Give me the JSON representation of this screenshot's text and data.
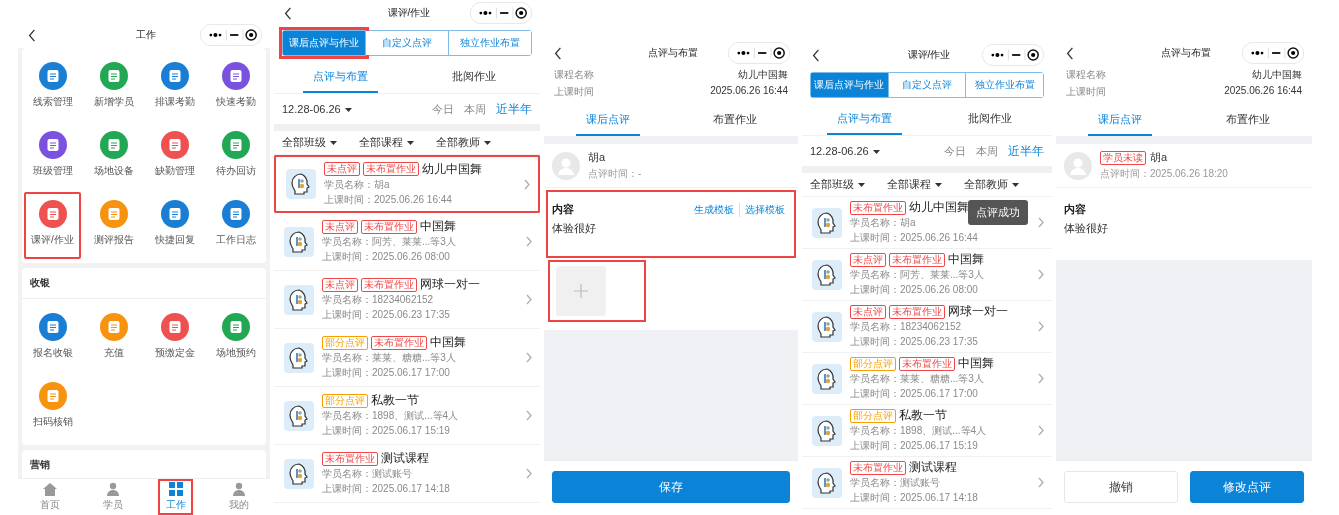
{
  "screens": [
    {
      "kind": "work_menu",
      "title": "工作",
      "sections": [
        {
          "items": [
            {
              "label": "线索管理",
              "color": "#1a7fd4",
              "highlighted": false
            },
            {
              "label": "新增学员",
              "color": "#22a855",
              "highlighted": false
            },
            {
              "label": "排课考勤",
              "color": "#1a7fd4",
              "highlighted": false
            },
            {
              "label": "快速考勤",
              "color": "#7b52e0",
              "highlighted": false
            },
            {
              "label": "班级管理",
              "color": "#7b52e0",
              "highlighted": false
            },
            {
              "label": "场地设备",
              "color": "#22a855",
              "highlighted": false
            },
            {
              "label": "缺勤管理",
              "color": "#ef5050",
              "highlighted": false
            },
            {
              "label": "待办回访",
              "color": "#22a855",
              "highlighted": false
            },
            {
              "label": "课评/作业",
              "color": "#ef5050",
              "highlighted": true
            },
            {
              "label": "测评报告",
              "color": "#f7930e",
              "highlighted": false
            },
            {
              "label": "快捷回复",
              "color": "#1a7fd4",
              "highlighted": false
            },
            {
              "label": "工作日志",
              "color": "#1a7fd4",
              "highlighted": false
            }
          ]
        },
        {
          "title": "收银",
          "items": [
            {
              "label": "报名收银",
              "color": "#1a7fd4",
              "highlighted": false
            },
            {
              "label": "充值",
              "color": "#f7930e",
              "highlighted": false
            },
            {
              "label": "预缴定金",
              "color": "#ef5050",
              "highlighted": false
            },
            {
              "label": "场地预约",
              "color": "#22a855",
              "highlighted": false
            },
            {
              "label": "扫码核销",
              "color": "#f7930e",
              "highlighted": false
            }
          ]
        },
        {
          "title": "营销"
        }
      ],
      "nav": [
        {
          "label": "首页",
          "kind": "home",
          "selected": false,
          "highlighted": false
        },
        {
          "label": "学员",
          "kind": "person",
          "selected": false,
          "highlighted": false
        },
        {
          "label": "工作",
          "kind": "grid",
          "selected": true,
          "highlighted": true
        },
        {
          "label": "我的",
          "kind": "person",
          "selected": false,
          "highlighted": false
        }
      ]
    },
    {
      "kind": "lesson_list",
      "title": "课评/作业",
      "segments": [
        {
          "label": "课后点评与作业",
          "selected": true,
          "highlighted": true
        },
        {
          "label": "自定义点评",
          "selected": false,
          "highlighted": false
        },
        {
          "label": "独立作业布置",
          "selected": false,
          "highlighted": false
        }
      ],
      "tabs": [
        {
          "label": "点评与布置",
          "selected": true
        },
        {
          "label": "批阅作业",
          "selected": false
        }
      ],
      "date_range": "12.28-06.26",
      "quick_ranges": [
        {
          "label": "今日",
          "selected": false
        },
        {
          "label": "本周",
          "selected": false
        },
        {
          "label": "近半年",
          "selected": true
        }
      ],
      "filters": [
        "全部班级",
        "全部课程",
        "全部教师"
      ],
      "lessons": [
        {
          "tags": [
            {
              "label": "未点评",
              "color": "#f04848"
            },
            {
              "label": "未布置作业",
              "color": "#f04848"
            }
          ],
          "title": "幼儿中国舞",
          "students": "学员名称：胡a",
          "time": "上课时间：2025.06.26 16:44",
          "highlighted": true
        },
        {
          "tags": [
            {
              "label": "未点评",
              "color": "#f04848"
            },
            {
              "label": "未布置作业",
              "color": "#f04848"
            }
          ],
          "title": "中国舞",
          "students": "学员名称：阿芳、莱莱...等3人",
          "time": "上课时间：2025.06.26 08:00",
          "highlighted": false
        },
        {
          "tags": [
            {
              "label": "未点评",
              "color": "#f04848"
            },
            {
              "label": "未布置作业",
              "color": "#f04848"
            }
          ],
          "title": "网球一对一",
          "students": "学员名称：18234062152",
          "time": "上课时间：2025.06.23 17:35",
          "highlighted": false
        },
        {
          "tags": [
            {
              "label": "部分点评",
              "color": "#f5a000"
            },
            {
              "label": "未布置作业",
              "color": "#f04848"
            }
          ],
          "title": "中国舞",
          "students": "学员名称：莱莱、糖糖...等3人",
          "time": "上课时间：2025.06.17 17:00",
          "highlighted": false
        },
        {
          "tags": [
            {
              "label": "部分点评",
              "color": "#f5a000"
            }
          ],
          "title": "私教一节",
          "students": "学员名称：1898、测试...等4人",
          "time": "上课时间：2025.06.17 15:19",
          "highlighted": false
        },
        {
          "tags": [
            {
              "label": "未布置作业",
              "color": "#f04848"
            }
          ],
          "title": "测试课程",
          "students": "学员名称：测试账号",
          "time": "上课时间：2025.06.17 14:18",
          "highlighted": false
        }
      ]
    },
    {
      "kind": "review_detail",
      "title": "点评与布置",
      "info": [
        {
          "label": "课程名称",
          "value": "幼儿中国舞"
        },
        {
          "label": "上课时间",
          "value": "2025.06.26 16:44"
        }
      ],
      "tabs": [
        {
          "label": "课后点评",
          "selected": true
        },
        {
          "label": "布置作业",
          "selected": false
        }
      ],
      "student": {
        "name": "胡a",
        "review_time": "点评时间：-"
      },
      "content": {
        "heading": "内容",
        "text": "体验很好",
        "actions": [
          "生成模板",
          "选择模板"
        ],
        "highlighted": true
      },
      "upload": {
        "highlighted": true
      },
      "buttons": [
        {
          "label": "保存",
          "kind": "primary"
        }
      ]
    },
    {
      "kind": "lesson_list",
      "title": "课评/作业",
      "segments": [
        {
          "label": "课后点评与作业",
          "selected": true,
          "highlighted": false
        },
        {
          "label": "自定义点评",
          "selected": false,
          "highlighted": false
        },
        {
          "label": "独立作业布置",
          "selected": false,
          "highlighted": false
        }
      ],
      "tabs": [
        {
          "label": "点评与布置",
          "selected": true
        },
        {
          "label": "批阅作业",
          "selected": false
        }
      ],
      "date_range": "12.28-06.26",
      "quick_ranges": [
        {
          "label": "今日",
          "selected": false
        },
        {
          "label": "本周",
          "selected": false
        },
        {
          "label": "近半年",
          "selected": true
        }
      ],
      "filters": [
        "全部班级",
        "全部课程",
        "全部教师"
      ],
      "toast": "点评成功",
      "lessons": [
        {
          "tags": [
            {
              "label": "未布置作业",
              "color": "#f04848"
            }
          ],
          "title": "幼儿中国舞",
          "students": "学员名称：胡a",
          "time": "上课时间：2025.06.26 16:44",
          "highlighted": false
        },
        {
          "tags": [
            {
              "label": "未点评",
              "color": "#f04848"
            },
            {
              "label": "未布置作业",
              "color": "#f04848"
            }
          ],
          "title": "中国舞",
          "students": "学员名称：阿芳、莱莱...等3人",
          "time": "上课时间：2025.06.26 08:00",
          "highlighted": false
        },
        {
          "tags": [
            {
              "label": "未点评",
              "color": "#f04848"
            },
            {
              "label": "未布置作业",
              "color": "#f04848"
            }
          ],
          "title": "网球一对一",
          "students": "学员名称：18234062152",
          "time": "上课时间：2025.06.23 17:35",
          "highlighted": false
        },
        {
          "tags": [
            {
              "label": "部分点评",
              "color": "#f5a000"
            },
            {
              "label": "未布置作业",
              "color": "#f04848"
            }
          ],
          "title": "中国舞",
          "students": "学员名称：莱莱、糖糖...等3人",
          "time": "上课时间：2025.06.17 17:00",
          "highlighted": false
        },
        {
          "tags": [
            {
              "label": "部分点评",
              "color": "#f5a000"
            }
          ],
          "title": "私教一节",
          "students": "学员名称：1898、测试...等4人",
          "time": "上课时间：2025.06.17 15:19",
          "highlighted": false
        },
        {
          "tags": [
            {
              "label": "未布置作业",
              "color": "#f04848"
            }
          ],
          "title": "测试课程",
          "students": "学员名称：测试账号",
          "time": "上课时间：2025.06.17 14:18",
          "highlighted": false
        }
      ]
    },
    {
      "kind": "review_detail",
      "title": "点评与布置",
      "info": [
        {
          "label": "课程名称",
          "value": "幼儿中国舞"
        },
        {
          "label": "上课时间",
          "value": "2025.06.26 16:44"
        }
      ],
      "tabs": [
        {
          "label": "课后点评",
          "selected": true
        },
        {
          "label": "布置作业",
          "selected": false
        }
      ],
      "student": {
        "name": "胡a",
        "review_time": "点评时间：2025.06.26 18:20",
        "tags": [
          {
            "label": "学员未读",
            "color": "#f04848"
          }
        ]
      },
      "content": {
        "heading": "内容",
        "text": "体验很好",
        "highlighted": false
      },
      "buttons": [
        {
          "label": "撤销",
          "kind": "secondary"
        },
        {
          "label": "修改点评",
          "kind": "primary"
        }
      ]
    }
  ]
}
